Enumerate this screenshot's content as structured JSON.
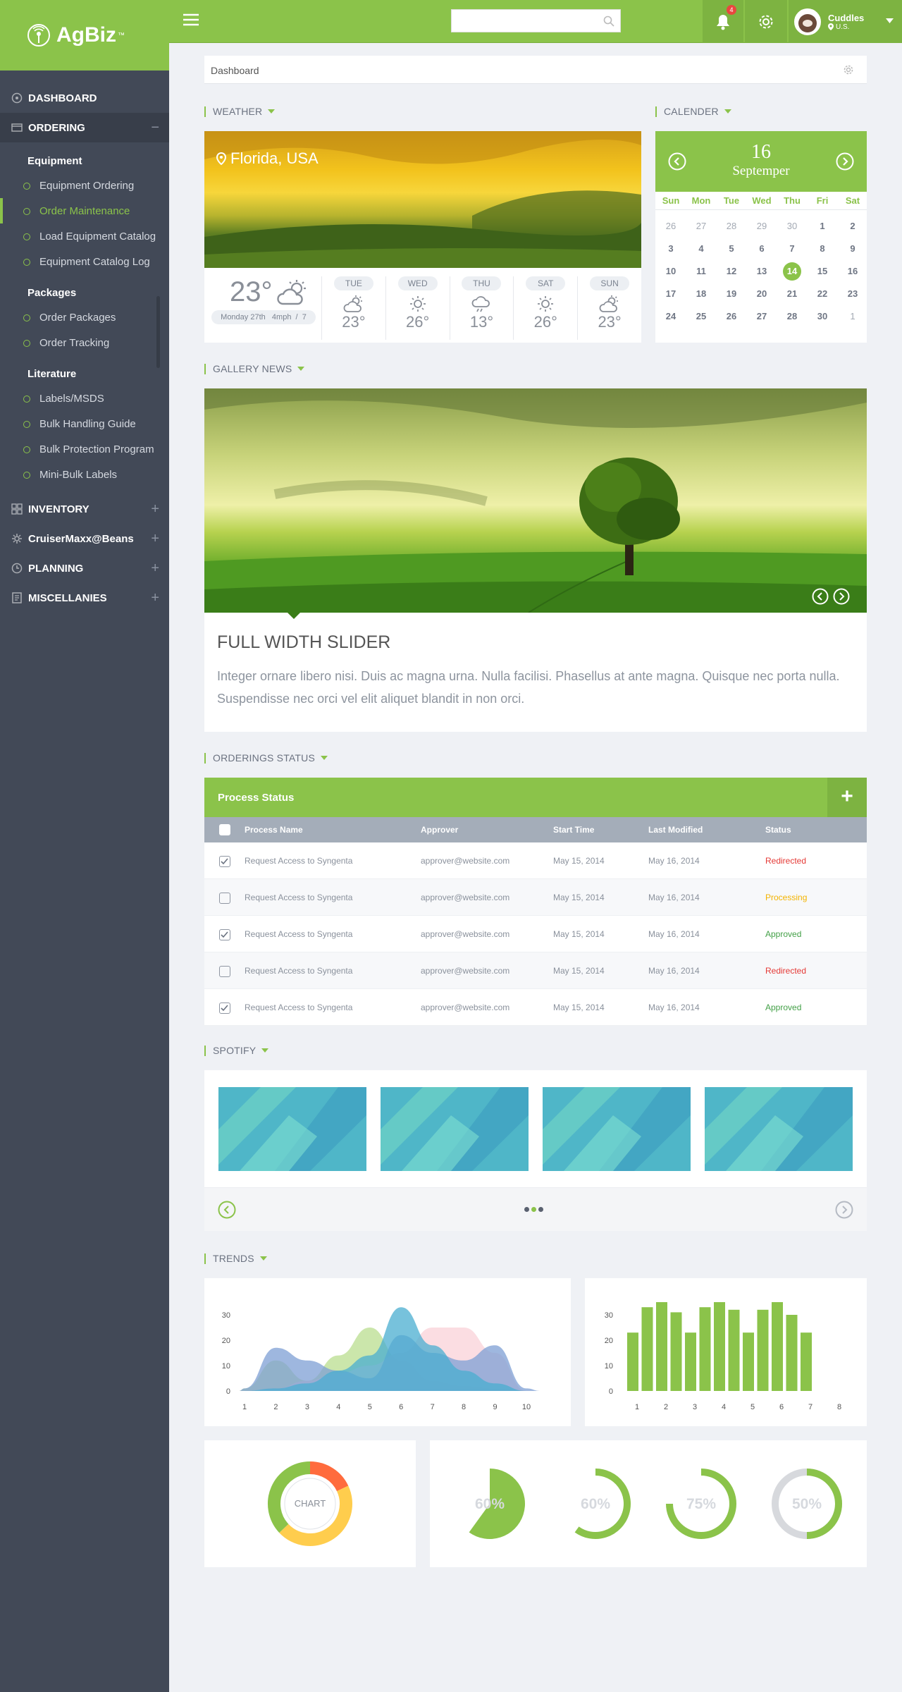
{
  "brand": {
    "name": "AgBiz",
    "tm": "™"
  },
  "sidebar": {
    "dashboard": "DASHBOARD",
    "ordering": "ORDERING",
    "groups": [
      {
        "title": "Equipment",
        "items": [
          "Equipment Ordering",
          "Order Maintenance",
          "Load Equipment Catalog",
          "Equipment Catalog Log"
        ]
      },
      {
        "title": "Packages",
        "items": [
          "Order Packages",
          "Order Tracking"
        ]
      },
      {
        "title": "Literature",
        "items": [
          "Labels/MSDS",
          "Bulk Handling Guide",
          "Bulk Protection Program",
          "Mini-Bulk Labels"
        ]
      }
    ],
    "active_item": "Order Maintenance",
    "collapsed": [
      "INVENTORY",
      "CruiserMaxx@Beans",
      "PLANNING",
      "MISCELLANIES"
    ],
    "ordering_toggle": "−",
    "plus": "+"
  },
  "topbar": {
    "search_placeholder": "",
    "notification_count": "4",
    "user_name": "Cuddles",
    "user_location": "U.S."
  },
  "breadcrumb": "Dashboard",
  "weather": {
    "section": "WEATHER",
    "location": "Florida, USA",
    "current_temp": "23°",
    "current_meta": "Monday 27th   4mph  /  7",
    "forecast": [
      {
        "day": "TUE",
        "temp": "23°",
        "icon": "cloud-sun-icon"
      },
      {
        "day": "WED",
        "temp": "26°",
        "icon": "sun-icon"
      },
      {
        "day": "THU",
        "temp": "13°",
        "icon": "cloud-rain-icon"
      },
      {
        "day": "SAT",
        "temp": "26°",
        "icon": "sun-icon"
      },
      {
        "day": "SUN",
        "temp": "23°",
        "icon": "cloud-sun-icon"
      }
    ]
  },
  "calendar": {
    "section": "CALENDER",
    "day": "16",
    "month": "Septemper",
    "weekdays": [
      "Sun",
      "Mon",
      "Tue",
      "Wed",
      "Thu",
      "Fri",
      "Sat"
    ],
    "weeks": [
      [
        "26",
        "27",
        "28",
        "29",
        "30",
        "1",
        "2"
      ],
      [
        "3",
        "4",
        "5",
        "6",
        "7",
        "8",
        "9"
      ],
      [
        "10",
        "11",
        "12",
        "13",
        "14",
        "15",
        "16"
      ],
      [
        "17",
        "18",
        "19",
        "20",
        "21",
        "22",
        "23"
      ],
      [
        "24",
        "25",
        "26",
        "27",
        "28",
        "30",
        "1"
      ]
    ],
    "selected": "14"
  },
  "gallery": {
    "section": "GALLERY NEWS",
    "title": "FULL WIDTH SLIDER",
    "text": "Integer ornare libero nisi. Duis ac magna urna. Nulla facilisi. Phasellus at ante magna. Quisque nec porta nulla. Suspendisse nec orci vel elit aliquet blandit in non orci."
  },
  "orderings": {
    "section": "ORDERINGS STATUS",
    "panel_title": "Process Status",
    "add_label": "+",
    "columns": [
      "Process Name",
      "Approver",
      "Start Time",
      "Last Modified",
      "Status"
    ],
    "rows": [
      {
        "name": "Request Access to Syngenta",
        "approver": "approver@website.com",
        "start": "May 15, 2014",
        "modified": "May 16, 2014",
        "status": "Redirected",
        "checked": true
      },
      {
        "name": "Request Access to Syngenta",
        "approver": "approver@website.com",
        "start": "May 15, 2014",
        "modified": "May 16, 2014",
        "status": "Processing",
        "checked": false
      },
      {
        "name": "Request Access to Syngenta",
        "approver": "approver@website.com",
        "start": "May 15, 2014",
        "modified": "May 16, 2014",
        "status": "Approved",
        "checked": true
      },
      {
        "name": "Request Access to Syngenta",
        "approver": "approver@website.com",
        "start": "May 15, 2014",
        "modified": "May 16, 2014",
        "status": "Redirected",
        "checked": false
      },
      {
        "name": "Request Access to Syngenta",
        "approver": "approver@website.com",
        "start": "May 15, 2014",
        "modified": "May 16, 2014",
        "status": "Approved",
        "checked": true
      }
    ],
    "status_colors": {
      "Redirected": "#e53935",
      "Processing": "#f4b400",
      "Approved": "#43a047"
    }
  },
  "spotify": {
    "section": "SPOTIFY",
    "tiles": 4,
    "pages": 3,
    "active_page": 1
  },
  "trends": {
    "section": "TRENDS"
  },
  "colors": {
    "accent": "#8bc34a",
    "sidebar": "#424957",
    "table_header": "#a4adb9"
  },
  "chart_data": [
    {
      "type": "area",
      "x": [
        1,
        2,
        3,
        4,
        5,
        6,
        7,
        8,
        9,
        10
      ],
      "ylim": [
        0,
        30
      ],
      "yticks": [
        0,
        10,
        20,
        30
      ],
      "series": [
        {
          "color": "#b9dd8f",
          "values": [
            1,
            12,
            4,
            14,
            25,
            12,
            4,
            2,
            1,
            0
          ]
        },
        {
          "color": "#f9d2d8",
          "values": [
            0,
            1,
            4,
            7,
            10,
            15,
            25,
            25,
            15,
            0
          ]
        },
        {
          "color": "#7e9fd4",
          "values": [
            1,
            17,
            12,
            8,
            5,
            22,
            15,
            12,
            18,
            1
          ]
        },
        {
          "color": "#4aaed0",
          "values": [
            0,
            1,
            3,
            8,
            14,
            33,
            18,
            8,
            3,
            0
          ]
        }
      ]
    },
    {
      "type": "bar",
      "categories": [
        "1",
        "",
        "2",
        "",
        "3",
        "",
        "4",
        "",
        "5",
        "",
        "6",
        "",
        "7",
        "",
        "8"
      ],
      "values": [
        23,
        33,
        35,
        31,
        23,
        33,
        35,
        32,
        23,
        32,
        35,
        30,
        23
      ],
      "xticks": [
        "1",
        "2",
        "3",
        "4",
        "5",
        "6",
        "7",
        "8"
      ],
      "yticks": [
        0,
        10,
        20,
        30
      ],
      "ylim": [
        0,
        30
      ],
      "color": "#8bc34a"
    },
    {
      "type": "pie",
      "label": "CHART",
      "values": [
        18,
        45,
        37
      ],
      "colors": [
        "#ff6b3d",
        "#ffcd4d",
        "#8bc34a"
      ]
    },
    {
      "type": "pie",
      "label": "60%",
      "values": [
        60,
        40
      ],
      "style": "pie"
    },
    {
      "type": "pie",
      "label": "60%",
      "values": [
        60,
        40
      ],
      "style": "ring"
    },
    {
      "type": "pie",
      "label": "75%",
      "values": [
        75,
        25
      ],
      "style": "ring"
    },
    {
      "type": "pie",
      "label": "50%",
      "values": [
        50,
        50
      ],
      "style": "ring-grey"
    }
  ]
}
